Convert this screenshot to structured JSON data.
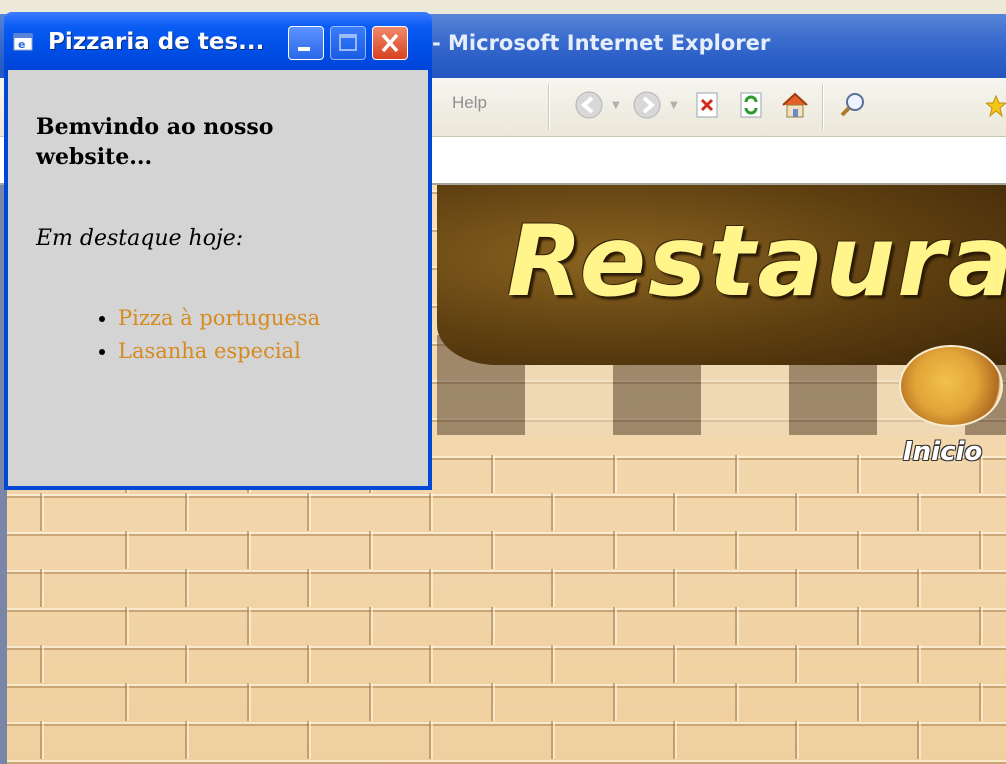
{
  "ie": {
    "title": "- Microsoft Internet Explorer",
    "menu_help": "Help",
    "toolbar": [
      "back-icon",
      "forward-icon",
      "stop-icon",
      "refresh-icon",
      "home-icon",
      "search-icon"
    ]
  },
  "page": {
    "banner_title": "Restauran",
    "nav_inicio": "Inicio"
  },
  "popup": {
    "title": "Pizzaria de tes...",
    "welcome": "Bemvindo ao nosso website...",
    "featured_label": "Em destaque hoje:",
    "specials": [
      "Pizza à portuguesa",
      "Lasanha especial"
    ]
  },
  "colors": {
    "xp_title_blue": "#0050e8",
    "popup_body": "#d4d4d4",
    "link_orange": "#d68a1f",
    "banner_text": "#fff58a"
  }
}
